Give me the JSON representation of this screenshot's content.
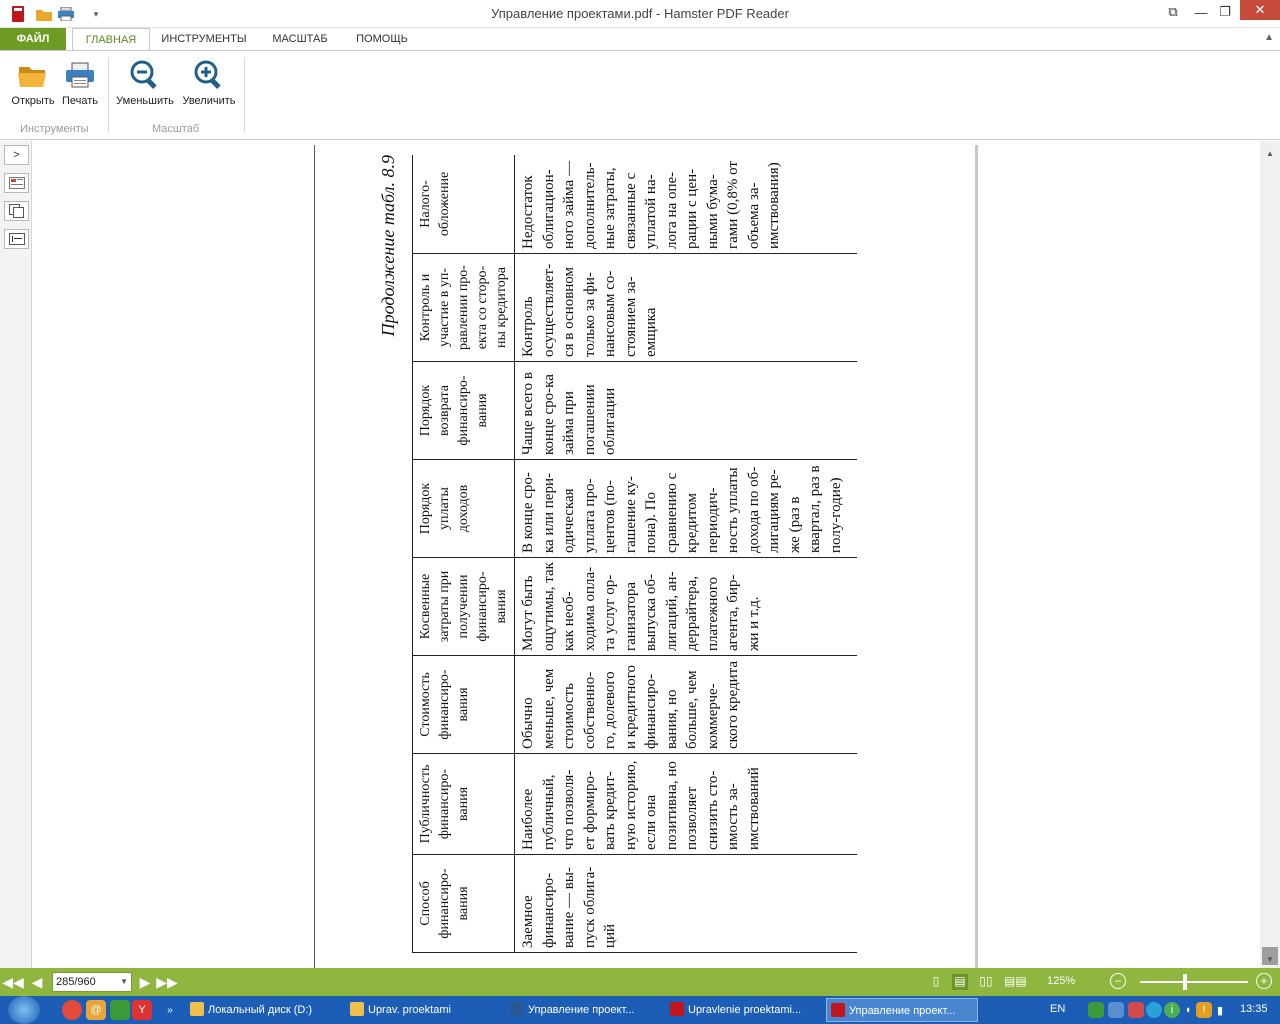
{
  "window": {
    "title": "Управление проектами.pdf - Hamster PDF Reader",
    "controls": {
      "restore": "⧉",
      "minimize": "—",
      "maximize": "❐",
      "close": "✕"
    }
  },
  "ribbon_tabs": [
    "ФАЙЛ",
    "ГЛАВНАЯ",
    "ИНСТРУМЕНТЫ",
    "МАСШТАБ",
    "ПОМОЩЬ"
  ],
  "ribbon": {
    "tools_group": "Инструменты",
    "scale_group": "Масштаб",
    "open": "Открыть",
    "print": "Печать",
    "zoom_out": "Уменьшить",
    "zoom_in": "Увеличить"
  },
  "document": {
    "caption": "Продолжение табл. 8.9",
    "headers": [
      "Способ финансиро-вания",
      "Публичность финансиро-вания",
      "Стоимость финансиро-вания",
      "Косвенные затраты при получении финансиро-вания",
      "Порядок уплаты доходов",
      "Порядок возврата финансиро-вания",
      "Контроль и участие в уп-равлении про-екта со сторо-ны кредитора",
      "Налого-обложение"
    ],
    "cells": [
      "Заемное финансиро-вание — вы-пуск облига-ций",
      "Наиболее публичный, что позволя-ет формиро-вать кредит-ную историю, если она позитивна, но позволяет снизить сто-имость за-имствований",
      "Обычно меньше, чем стоимость собственно-го, долевого и кредитного финансиро-вания, но больше, чем коммерче-ского кредита",
      "Могут быть ощутимы, так как необ-ходима опла-та услуг ор-ганизатора выпуска об-лигаций, ан-деррайтера, платежного агента, бир-жи и т.д.",
      "В конце сро-ка или пери-одическая уплата про-центов (по-гашение ку-пона). По сравнению с кредитом периодич-ность уплаты дохода по об-лигациям ре-же (раз в квартал, раз в полу-годие)",
      "Чаще всего в конце сро-ка займа при погашении облигации",
      "Контроль осуществляет-ся в основном только за фи-нансовым со-стоянием за-емщика",
      "Недостаток облигацион-ного займа — дополнитель-ные затраты, связанные с уплатой на-лога на опе-рации с цен-ными бума-гами (0,8% от объема за-имствования)"
    ]
  },
  "statusbar": {
    "page": "285/960",
    "zoom": "125%",
    "zoom_level": 0.42
  },
  "taskbar": {
    "tasks": [
      "Локальный диск (D:)",
      "Uprav. proektami",
      "Управление проект...",
      "Upravlenie proektami...",
      "Управление проект..."
    ],
    "lang": "EN",
    "time": "13:35"
  }
}
